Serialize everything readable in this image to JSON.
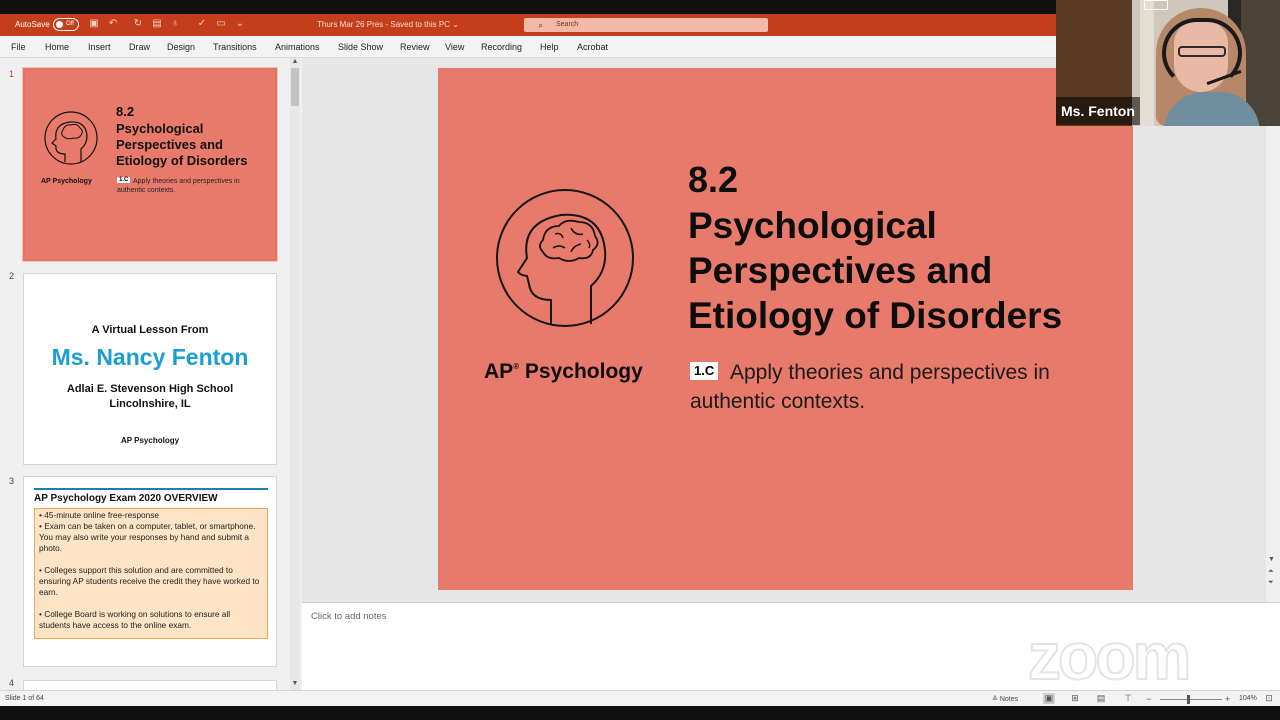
{
  "titlebar": {
    "autosave_label": "AutoSave",
    "autosave_state": "Off",
    "document_title": "Thurs Mar 26 Pres  -  Saved to this PC  ⌄",
    "search_placeholder": "Search",
    "accent_color": "#c43e1c"
  },
  "menu": [
    "File",
    "Home",
    "Insert",
    "Draw",
    "Design",
    "Transitions",
    "Animations",
    "Slide Show",
    "Review",
    "View",
    "Recording",
    "Help",
    "Acrobat"
  ],
  "thumbnails": {
    "numbers": [
      "1",
      "2",
      "3",
      "4"
    ],
    "slide1": {
      "number": "8.2",
      "title": "Psychological Perspectives and Etiology of Disorders",
      "course": "AP Psychology",
      "tag": "1.C",
      "subtitle": "Apply theories and perspectives in authentic contexts."
    },
    "slide2": {
      "intro": "A Virtual Lesson From",
      "name": "Ms. Nancy Fenton",
      "school_line1": "Adlai E. Stevenson High School",
      "school_line2": "Lincolnshire, IL",
      "course": "AP Psychology"
    },
    "slide3": {
      "header": "AP Psychology Exam 2020 OVERVIEW",
      "bullet1": "• 45-minute online free-response",
      "bullet2": "• Exam can be taken on a computer, tablet, or smartphone. You may also write your responses by hand and submit a photo.",
      "bullet3": "• Colleges support this solution and are committed to ensuring AP students receive the credit they have worked to earn.",
      "bullet4": "• College Board is working on solutions to ensure all students have access to the online exam."
    }
  },
  "slide": {
    "number": "8.2",
    "title": "Psychological Perspectives and Etiology of Disorders",
    "course": "AP",
    "course_reg": "®",
    "course_rest": " Psychology",
    "tag": "1.C",
    "subtitle": "Apply theories and perspectives in authentic contexts.",
    "background_color": "#e87a6b"
  },
  "notes": {
    "placeholder": "Click to add notes"
  },
  "statusbar": {
    "slide_indicator": "Slide 1 of 64",
    "notes_label": "Notes",
    "zoom_level": "104%"
  },
  "webcam": {
    "participant_name": "Ms. Fenton"
  },
  "zoom_watermark": "zoom"
}
